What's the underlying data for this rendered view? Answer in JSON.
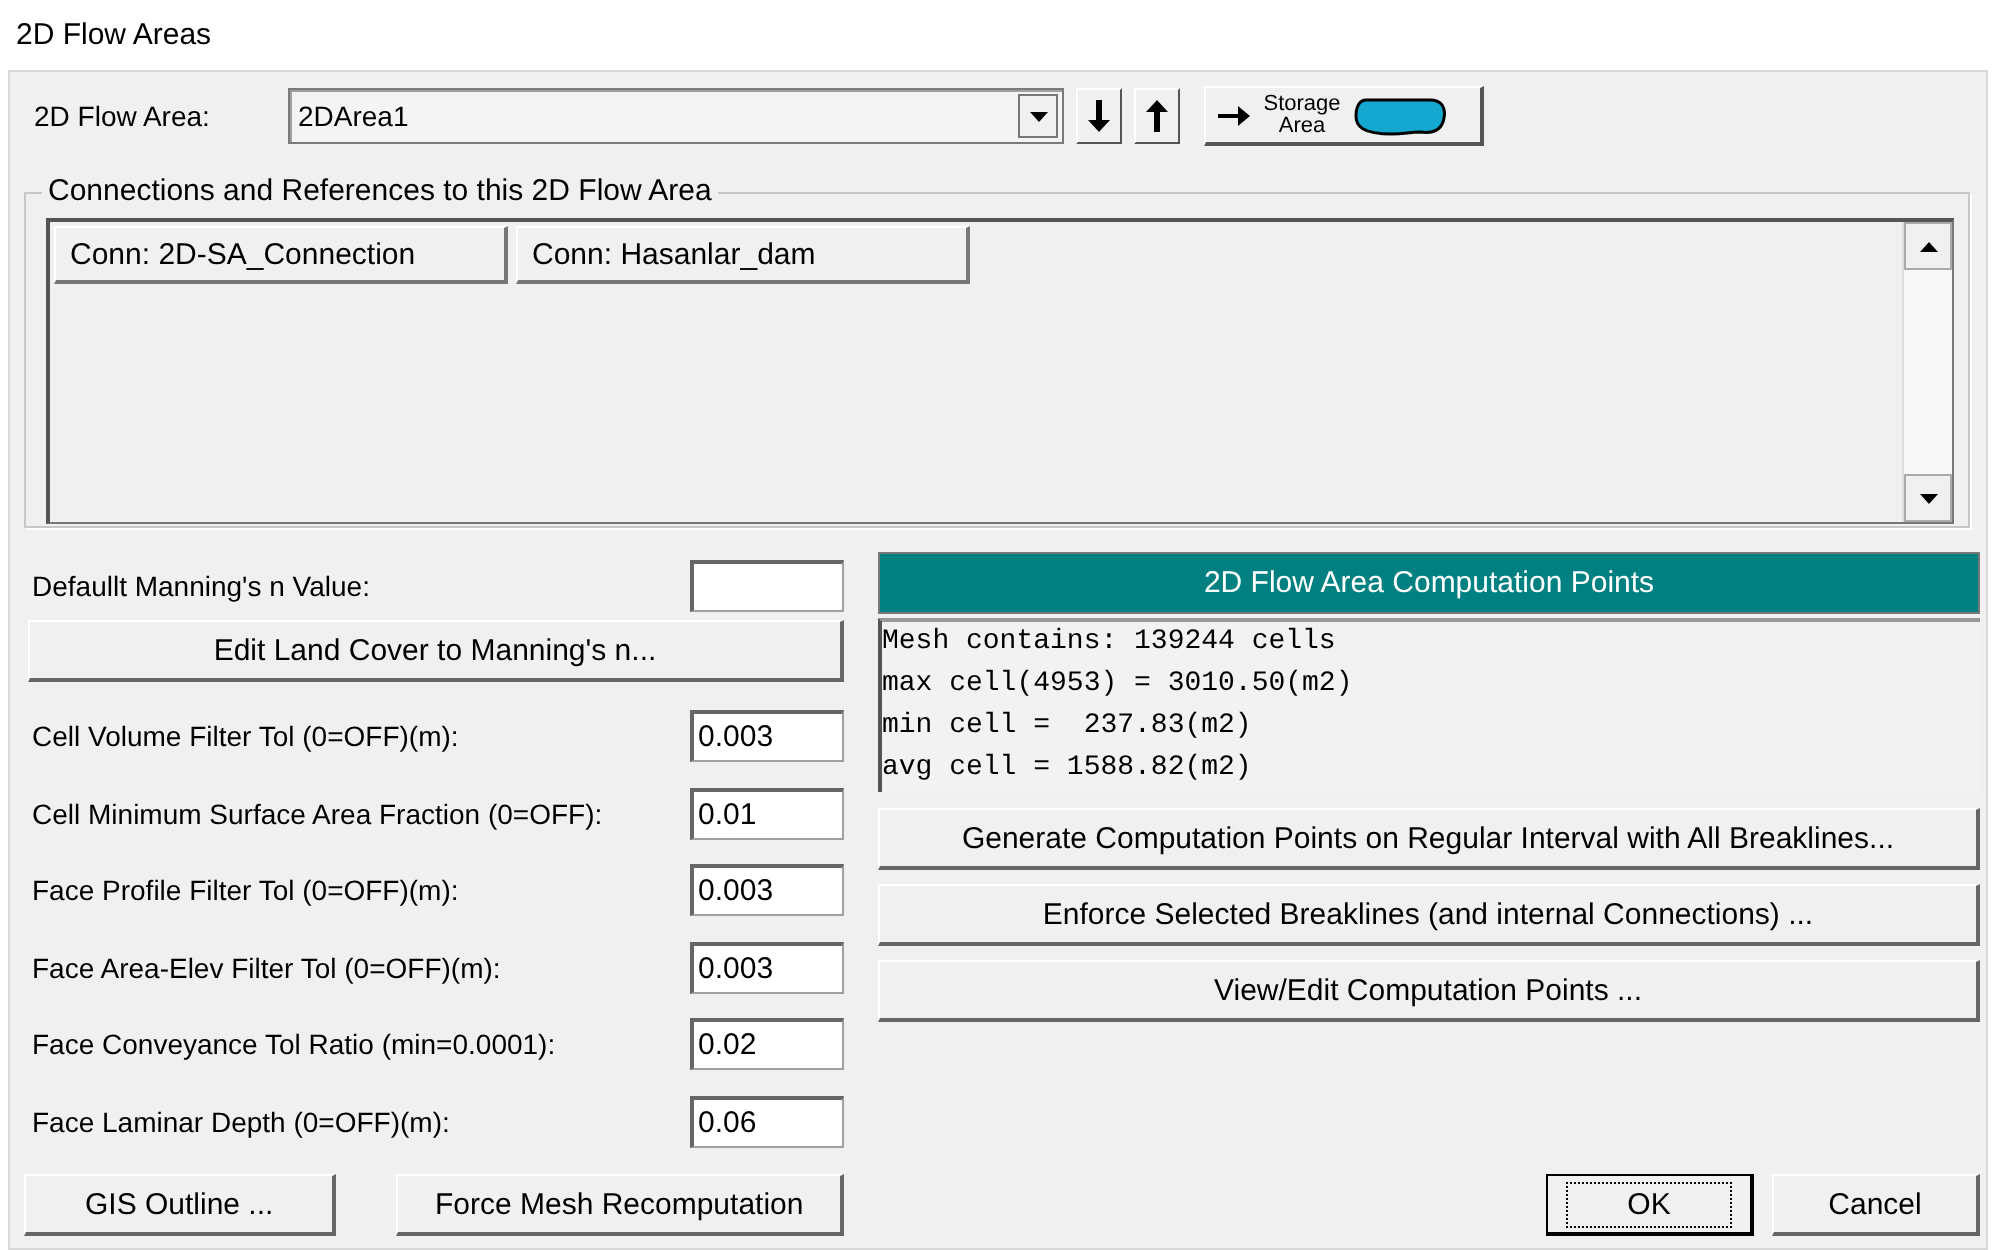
{
  "window": {
    "title": "2D Flow Areas"
  },
  "flow_area": {
    "label": "2D Flow Area:",
    "value": "2DArea1",
    "storage_button": "Storage Area"
  },
  "connections": {
    "title": "Connections and References to this 2D Flow Area",
    "items": [
      {
        "label": "Conn: 2D-SA_Connection"
      },
      {
        "label": "Conn: Hasanlar_dam"
      }
    ]
  },
  "manning": {
    "label": "Defaullt Manning's n Value:",
    "button": "Edit Land Cover to Manning's n..."
  },
  "fields": [
    {
      "label": "Cell Volume Filter Tol (0=OFF)(m):",
      "value": "0.003"
    },
    {
      "label": "Cell Minimum Surface Area Fraction (0=OFF):",
      "value": "0.01"
    },
    {
      "label": "Face Profile Filter Tol (0=OFF)(m):",
      "value": "0.003"
    },
    {
      "label": "Face Area-Elev Filter Tol (0=OFF)(m):",
      "value": "0.003"
    },
    {
      "label": "Face Conveyance Tol Ratio (min=0.0001):",
      "value": "0.02"
    },
    {
      "label": "Face Laminar Depth (0=OFF)(m):",
      "value": "0.06"
    }
  ],
  "bottom_buttons": [
    "GIS Outline ...",
    "Force Mesh Recomputation"
  ],
  "computation": {
    "header": "2D Flow Area Computation Points",
    "lines": [
      "Mesh contains: 139244 cells",
      "max cell(4953) = 3010.50(m2)",
      "min cell =  237.83(m2)",
      "avg cell = 1588.82(m2)"
    ],
    "buttons": [
      "Generate Computation Points on Regular Interval with All Breaklines...",
      "Enforce Selected Breaklines (and internal Connections) ...",
      "View/Edit Computation Points ..."
    ]
  },
  "dialog_buttons": [
    {
      "label": "OK",
      "focused": true
    },
    {
      "label": "Cancel",
      "focused": false
    }
  ]
}
